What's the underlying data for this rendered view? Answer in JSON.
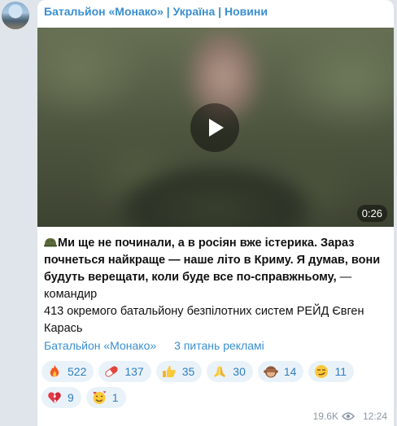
{
  "channel": {
    "title": "Батальйон «Монако» | Україна | Новини"
  },
  "video": {
    "duration": "0:26"
  },
  "post": {
    "bold_lines": [
      "Ми ще не починали, а в росіян вже істерика. Зараз",
      "почнеться найкраще — наше літо в Криму. Я думав, вони",
      "будуть верещати, коли буде все по-справжньому,"
    ],
    "rest_text": " — командир",
    "line4": "413 окремого батальйону безпілотних систем РЕЙД Євген",
    "line5": "Карась"
  },
  "links": {
    "channel": "Батальйон «Монако»",
    "ads": "3 питань рекламі"
  },
  "reactions": [
    {
      "icon": "fire-icon",
      "count": "522"
    },
    {
      "icon": "pill-icon",
      "count": "137"
    },
    {
      "icon": "thumbs-up-icon",
      "count": "35"
    },
    {
      "icon": "praying-hands-icon",
      "count": "30"
    },
    {
      "icon": "see-no-evil-monkey-icon",
      "count": "14"
    },
    {
      "icon": "smirk-face-icon",
      "count": "11"
    },
    {
      "icon": "broken-heart-icon",
      "count": "9"
    },
    {
      "icon": "smiling-hearts-face-icon",
      "count": "1"
    }
  ],
  "meta": {
    "views": "19.6K",
    "time": "12:24"
  },
  "colors": {
    "accent": "#3a8fd0",
    "reaction_bg": "#eaf2f9",
    "chat_bg": "#dfe5ea"
  }
}
